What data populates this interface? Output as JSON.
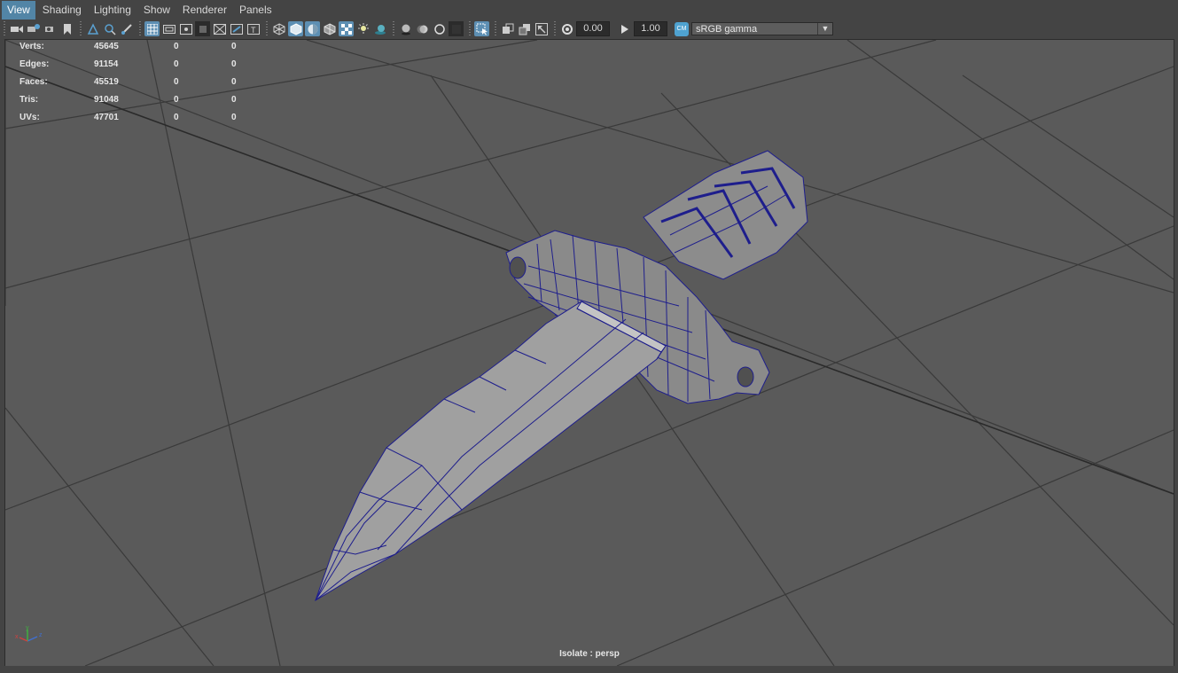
{
  "menubar": {
    "items": [
      "View",
      "Shading",
      "Lighting",
      "Show",
      "Renderer",
      "Panels"
    ],
    "active_index": 0
  },
  "toolbar": {
    "exposure_value": "0.00",
    "gamma_value": "1.00",
    "color_management_icon_text": "CM",
    "color_space": "sRGB gamma"
  },
  "hud": {
    "rows": [
      {
        "label": "Verts:",
        "values": [
          "45645",
          "0",
          "0"
        ]
      },
      {
        "label": "Edges:",
        "values": [
          "91154",
          "0",
          "0"
        ]
      },
      {
        "label": "Faces:",
        "values": [
          "45519",
          "0",
          "0"
        ]
      },
      {
        "label": "Tris:",
        "values": [
          "91048",
          "0",
          "0"
        ]
      },
      {
        "label": "UVs:",
        "values": [
          "47701",
          "0",
          "0"
        ]
      }
    ]
  },
  "viewport": {
    "isolate_label": "Isolate : persp",
    "axis_labels": {
      "x": "x",
      "y": "y",
      "z": "z"
    }
  },
  "colors": {
    "active_menu": "#5285a6",
    "viewport_bg": "#5a5a5a",
    "wireframe": "#1e1e8c",
    "mesh_fill": "#9a9a9a"
  }
}
